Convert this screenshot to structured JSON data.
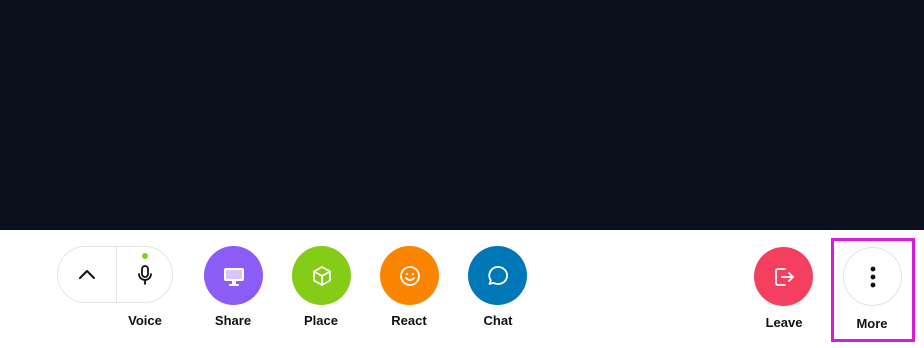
{
  "colors": {
    "stage_bg": "#0b111c",
    "share": "#8b5cf6",
    "place": "#84cc16",
    "react": "#fb8500",
    "chat": "#0077b6",
    "leave": "#f43f5e",
    "mic_indicator": "#7ed321",
    "highlight": "#d81bd8"
  },
  "toolbar": {
    "voice": {
      "label": "Voice",
      "expand_icon": "chevron-up-icon",
      "mic_icon": "microphone-icon"
    },
    "share": {
      "label": "Share",
      "icon": "monitor-icon"
    },
    "place": {
      "label": "Place",
      "icon": "cube-icon"
    },
    "react": {
      "label": "React",
      "icon": "smile-icon"
    },
    "chat": {
      "label": "Chat",
      "icon": "chat-bubble-icon"
    },
    "leave": {
      "label": "Leave",
      "icon": "exit-icon"
    },
    "more": {
      "label": "More",
      "icon": "vertical-dots-icon"
    }
  }
}
